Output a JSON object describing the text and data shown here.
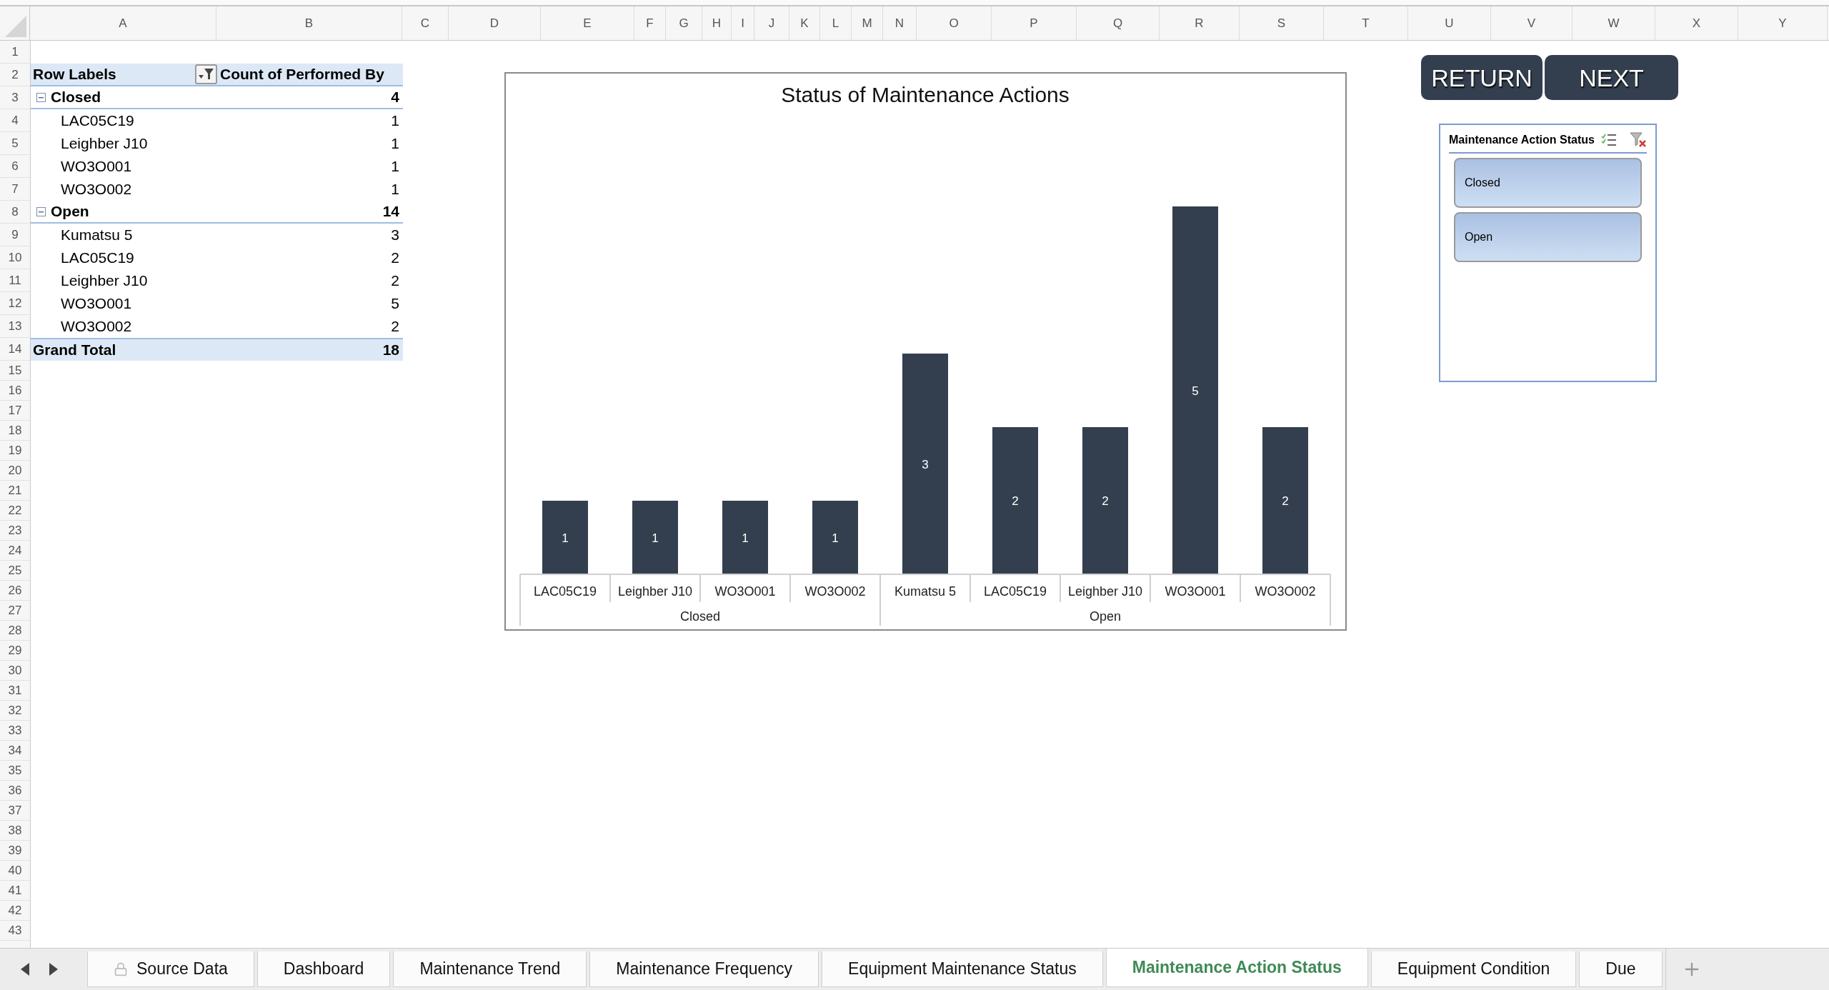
{
  "column_headers": [
    "A",
    "B",
    "C",
    "D",
    "E",
    "F",
    "G",
    "H",
    "I",
    "J",
    "K",
    "L",
    "M",
    "N",
    "O",
    "P",
    "Q",
    "R",
    "S",
    "T",
    "U",
    "V",
    "W",
    "X",
    "Y"
  ],
  "row_headers": [
    "1",
    "2",
    "3",
    "4",
    "5",
    "6",
    "7",
    "8",
    "9",
    "10",
    "11",
    "12",
    "13",
    "14",
    "15",
    "16",
    "17",
    "18",
    "19",
    "20",
    "21",
    "22",
    "23",
    "24",
    "25",
    "26",
    "27",
    "28",
    "29",
    "30",
    "31",
    "32",
    "33",
    "34",
    "35",
    "36",
    "37",
    "38",
    "39",
    "40",
    "41",
    "42",
    "43"
  ],
  "pivot_table": {
    "row_labels": "Row Labels",
    "value_label": "Count of Performed By",
    "groups": [
      {
        "label": "Closed",
        "total": "4",
        "expanded": true,
        "children": [
          {
            "label": "LAC05C19",
            "value": "1"
          },
          {
            "label": "Leighber J10",
            "value": "1"
          },
          {
            "label": "WO3O001",
            "value": "1"
          },
          {
            "label": "WO3O002",
            "value": "1"
          }
        ]
      },
      {
        "label": "Open",
        "total": "14",
        "expanded": true,
        "children": [
          {
            "label": "Kumatsu 5",
            "value": "3"
          },
          {
            "label": "LAC05C19",
            "value": "2"
          },
          {
            "label": "Leighber J10",
            "value": "2"
          },
          {
            "label": "WO3O001",
            "value": "5"
          },
          {
            "label": "WO3O002",
            "value": "2"
          }
        ]
      }
    ],
    "grand_total": {
      "label": "Grand Total",
      "value": "18"
    }
  },
  "chart": {
    "chart_data": {
      "type": "bar",
      "title": "Status of Maintenance Actions",
      "categories": [
        "LAC05C19",
        "Leighber J10",
        "WO3O001",
        "WO3O002",
        "Kumatsu 5",
        "LAC05C19",
        "Leighber J10",
        "WO3O001",
        "WO3O002"
      ],
      "series": [
        {
          "color": "#333f4f",
          "values": [
            1,
            1,
            1,
            1,
            3,
            2,
            2,
            5,
            2
          ]
        }
      ],
      "data_labels": true
    },
    "group_labels": [
      {
        "label": "Closed"
      },
      {
        "label": "Open"
      }
    ]
  },
  "buttons": [
    {
      "label": "RETURN"
    },
    {
      "label": "NEXT"
    }
  ],
  "slicer": {
    "title": "Maintenance Action Status",
    "items": [
      {
        "label": "Closed",
        "selected": true
      },
      {
        "label": "Open",
        "selected": true
      }
    ]
  },
  "sheet_tabs": [
    {
      "label": "Source Data",
      "locked": true,
      "selected": false
    },
    {
      "label": "Dashboard",
      "locked": false,
      "selected": false
    },
    {
      "label": "Maintenance Trend",
      "locked": false,
      "selected": false
    },
    {
      "label": "Maintenance Frequency",
      "locked": false,
      "selected": false
    },
    {
      "label": "Equipment Maintenance Status",
      "locked": false,
      "selected": false
    },
    {
      "label": "Maintenance Action Status",
      "locked": false,
      "selected": true
    },
    {
      "label": "Equipment Condition",
      "locked": false,
      "selected": false
    },
    {
      "label": "Due",
      "locked": false,
      "selected": false
    }
  ]
}
